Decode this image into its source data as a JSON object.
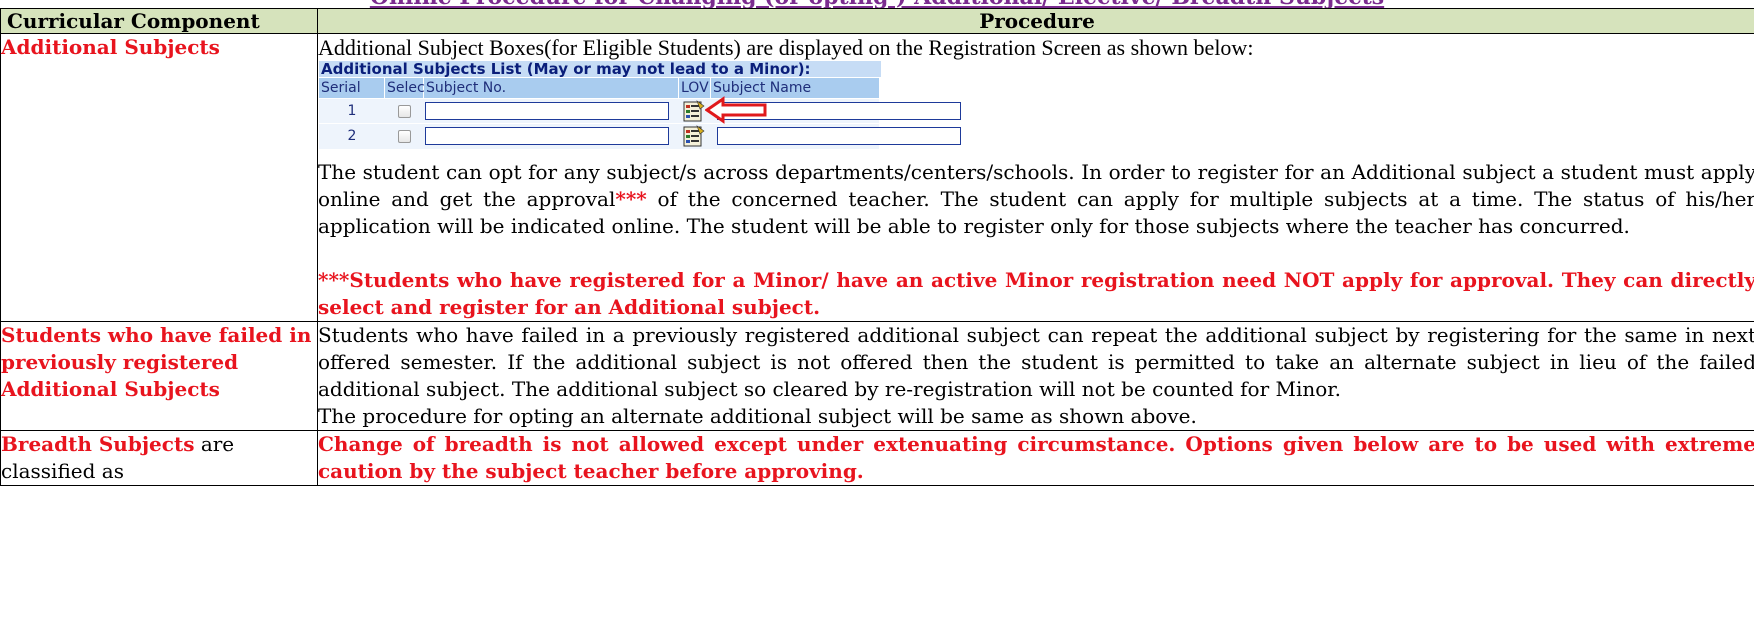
{
  "page_title": "Online Procedure for Changing (or opting ) Additional/ Elective/ Breadth Subjects",
  "table": {
    "headers": [
      "Curricular Component",
      "Procedure"
    ],
    "row1": {
      "component": "Additional Subjects",
      "intro": "Additional Subject Boxes(for Eligible Students) are displayed on the Registration Screen as shown below:",
      "screen": {
        "caption": "Additional Subjects List (May or may not lead to a Minor):",
        "columns": [
          "Serial No.",
          "Select",
          "Subject No.",
          "LOV",
          "Subject Name"
        ],
        "rows": [
          "1",
          "2"
        ]
      },
      "para_before": "The student can opt for any subject/s across departments/centers/schools. In order to register for an Additional subject a student must apply online and get the approval",
      "para_stars": "***",
      "para_after": " of the concerned teacher. The student can apply for multiple subjects at a time. The status of his/her application will be indicated online. The student will be able to register only for those subjects where the teacher has concurred.",
      "note": "***Students who have registered for a Minor/ have an active Minor registration need NOT apply for approval. They can directly select and register for an Additional subject."
    },
    "row2": {
      "component": "Students  who have failed in previously registered  Additional Subjects",
      "para": "Students who have failed in a previously registered additional subject can  repeat the additional subject by registering for  the same in  next offered semester. If the additional subject is not offered then the student is permitted to take an alternate subject in lieu of the failed additional subject. The additional subject so cleared by re-registration  will not be counted for Minor.",
      "para2": "The procedure for opting an alternate additional subject will be same as shown above."
    },
    "row3": {
      "component_bold": "Breadth Subjects",
      "component_rest": " are classified as",
      "note": "Change of breadth is not allowed except under extenuating circumstance. Options given below are to be used with extreme caution by the subject teacher before approving."
    }
  },
  "colors": {
    "header_bg": "#d6e3bc",
    "label_red": "#e8141e",
    "title_purple": "#7b2c8f"
  },
  "icons": [
    "list-of-values-icon",
    "red-arrow-icon",
    "checkbox-icon"
  ]
}
